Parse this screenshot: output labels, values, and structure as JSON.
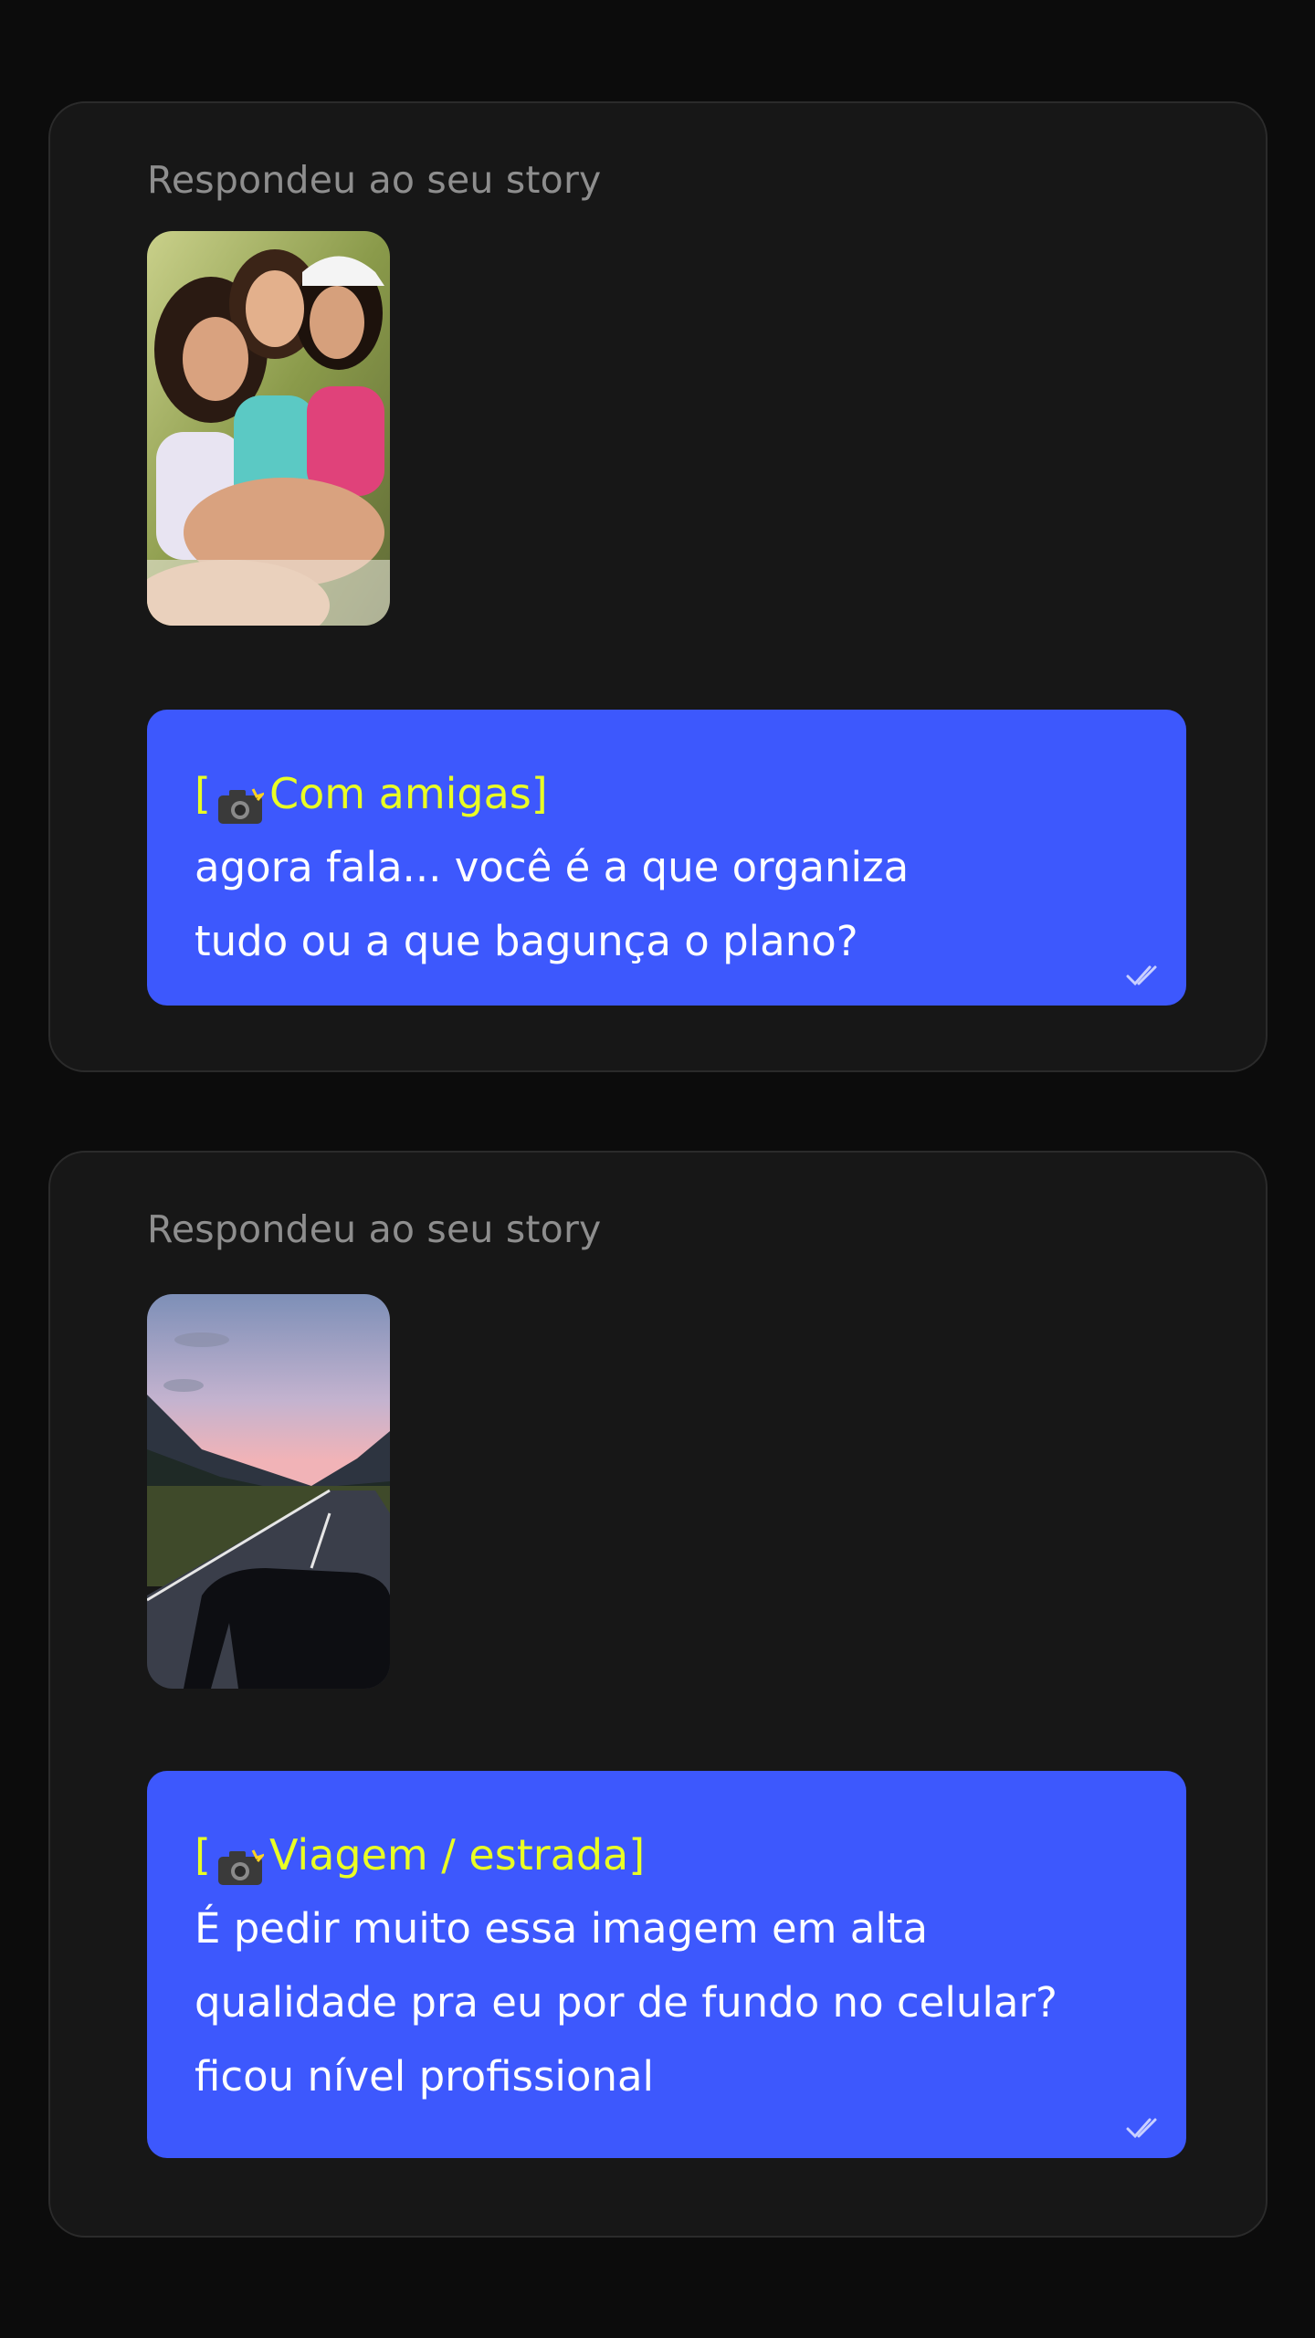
{
  "stories": [
    {
      "label": "Respondeu ao seu story",
      "image_alt": "três amigas sorrindo sentadas na grama",
      "tag": "Com amigas",
      "message_lines": [
        "agora fala... você é a que organiza",
        "tudo ou a que bagunça o plano?"
      ],
      "status_icon": "double-check-icon"
    },
    {
      "label": "Respondeu ao seu story",
      "image_alt": "estrada entre montanhas ao entardecer vista do carro",
      "tag": "Viagem / estrada",
      "message_lines": [
        "É pedir muito essa imagem em alta",
        "qualidade pra eu por de fundo no celular?",
        "ficou nível profissional"
      ],
      "status_icon": "double-check-icon"
    }
  ],
  "colors": {
    "background": "#0c0c0c",
    "card": "#171717",
    "bubble": "#3d58fd",
    "tag": "#eaff23",
    "label": "#8e8e8e"
  }
}
